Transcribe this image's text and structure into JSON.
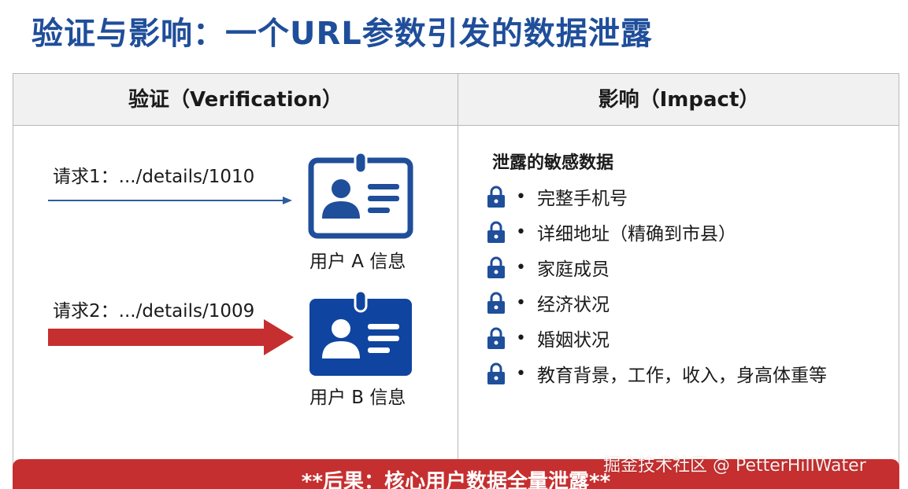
{
  "title": "验证与影响：一个URL参数引发的数据泄露",
  "table": {
    "verification_header": "验证（Verification）",
    "impact_header": "影响（Impact）"
  },
  "verification": {
    "request1": "请求1：.../details/1010",
    "request2": "请求2：.../details/1009",
    "user_a": "用户 A 信息",
    "user_b": "用户 B 信息"
  },
  "impact": {
    "heading": "泄露的敏感数据",
    "bullet": "•",
    "items": [
      "完整手机号",
      "详细地址（精确到市县）",
      "家庭成员",
      "经济状况",
      "婚姻状况",
      "教育背景，工作，收入，身高体重等"
    ]
  },
  "consequence": "**后果：核心用户数据全量泄露**",
  "watermark": "掘金技术社区 @ PetterHillWater",
  "icons": {
    "card": "id-card-icon",
    "lock": "lock-icon"
  },
  "colors": {
    "title": "#1f4e9a",
    "card_outline": "#1f4e9a",
    "card_filled": "#0f45a0",
    "lock": "#1f4e9a",
    "arrow_thin": "#2d5c9e",
    "arrow_thick": "#c62f2f",
    "banner": "#c62f2f"
  }
}
